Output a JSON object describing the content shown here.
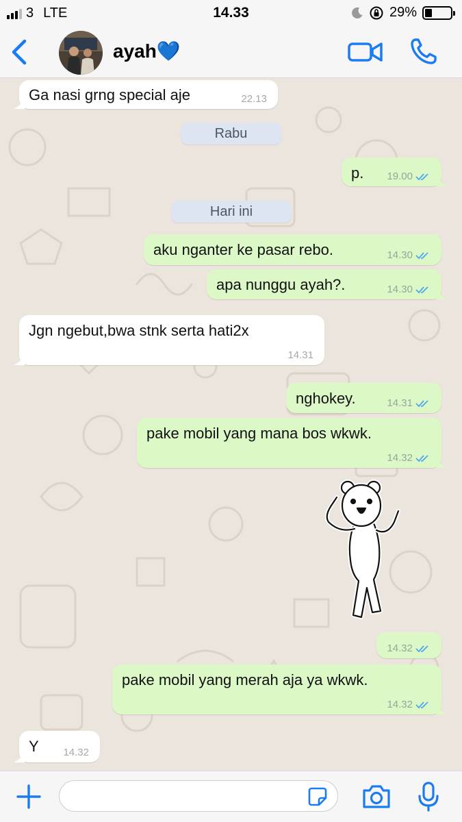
{
  "status_bar": {
    "carrier": "3",
    "network": "LTE",
    "time": "14.33",
    "battery": "29%",
    "battery_level": 0.29,
    "icons": [
      "signal-icon",
      "moon-icon",
      "rotation-lock-icon",
      "battery-icon"
    ]
  },
  "header": {
    "contact_name": "ayah💙",
    "icons": [
      "back-icon",
      "avatar",
      "video-call-icon",
      "phone-icon"
    ]
  },
  "colors": {
    "accent": "#1a7cf0",
    "incoming_bubble": "#ffffff",
    "outgoing_bubble": "#dcf8c6",
    "read_ticks": "#4fa8ec",
    "chat_background": "#ece5dd",
    "date_pill": "#dde4f2"
  },
  "messages": [
    {
      "dir": "in",
      "text": "Ga nasi grng special aje",
      "time": "22.13"
    },
    {
      "type": "date",
      "text": "Rabu"
    },
    {
      "dir": "out",
      "text": "p.",
      "time": "19.00"
    },
    {
      "type": "date",
      "text": "Hari ini"
    },
    {
      "dir": "out",
      "text": "aku nganter ke pasar rebo.",
      "time": "14.30"
    },
    {
      "dir": "out",
      "text": "apa nunggu ayah?.",
      "time": "14.30"
    },
    {
      "dir": "in",
      "text": "Jgn ngebut,bwa stnk serta hati2x",
      "time": "14.31"
    },
    {
      "dir": "out",
      "text": "nghokey.",
      "time": "14.31"
    },
    {
      "dir": "out",
      "text": "pake mobil yang mana bos wkwk.",
      "time": "14.32"
    },
    {
      "dir": "out",
      "type": "sticker",
      "sticker": "dancing-bear-sticker",
      "time": "14.32"
    },
    {
      "dir": "out",
      "text": "pake mobil yang merah aja ya wkwk.",
      "time": "14.32"
    },
    {
      "dir": "in",
      "text": "Y",
      "time": "14.32"
    }
  ],
  "input_bar": {
    "placeholder": "",
    "icons": [
      "plus-icon",
      "sticker-icon",
      "camera-icon",
      "microphone-icon"
    ]
  }
}
